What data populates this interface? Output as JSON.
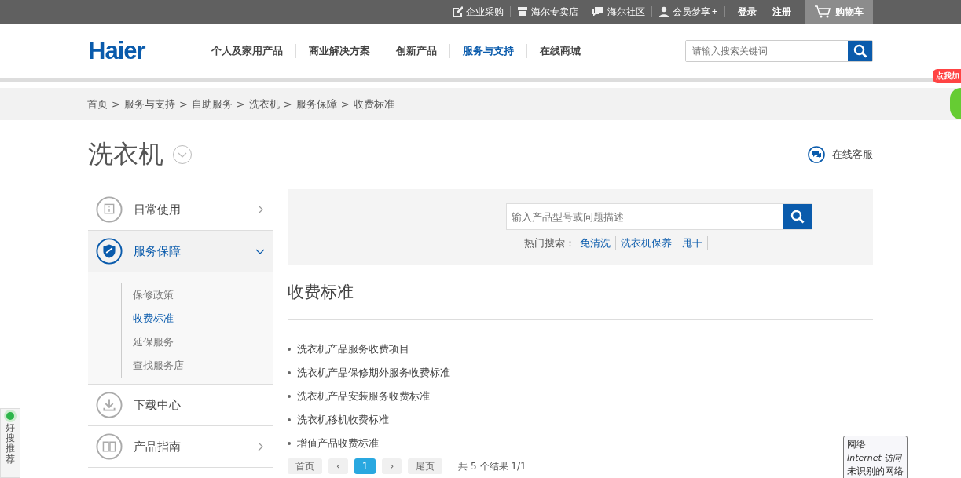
{
  "top_bar": {
    "links": [
      {
        "label": "企业采购"
      },
      {
        "label": "海尔专卖店"
      },
      {
        "label": "海尔社区"
      },
      {
        "label": "会员梦享",
        "sup": "+"
      }
    ],
    "login": "登录",
    "register": "注册",
    "cart": "购物车"
  },
  "header": {
    "logo": "Haier",
    "nav": [
      {
        "label": "个人及家用产品",
        "selected": false
      },
      {
        "label": "商业解决方案",
        "selected": false
      },
      {
        "label": "创新产品",
        "selected": false
      },
      {
        "label": "服务与支持",
        "selected": true
      },
      {
        "label": "在线商城",
        "selected": false
      }
    ],
    "search_placeholder": "请输入搜索关键词"
  },
  "breadcrumb": {
    "separator": ">",
    "items": [
      "首页",
      "服务与支持",
      "自助服务",
      "洗衣机",
      "服务保障",
      "收费标准"
    ]
  },
  "page_title": "洗衣机",
  "online_service": "在线客服",
  "sidebar": [
    {
      "label": "日常使用",
      "expanded": false,
      "chevron": true
    },
    {
      "label": "服务保障",
      "expanded": true,
      "chevron": true,
      "children": [
        {
          "label": "保修政策",
          "selected": false
        },
        {
          "label": "收费标准",
          "selected": true
        },
        {
          "label": "延保服务",
          "selected": false
        },
        {
          "label": "查找服务店",
          "selected": false
        }
      ]
    },
    {
      "label": "下载中心",
      "expanded": false,
      "chevron": false
    },
    {
      "label": "产品指南",
      "expanded": false,
      "chevron": true
    }
  ],
  "search_panel": {
    "placeholder": "输入产品型号或问题描述",
    "hot_label": "热门搜索：",
    "hot": [
      "免清洗",
      "洗衣机保养",
      "甩干"
    ]
  },
  "section_title": "收费标准",
  "items": [
    "洗衣机产品服务收费项目",
    "洗衣机产品保修期外服务收费标准",
    "洗衣机产品安装服务收费标准",
    "洗衣机移机收费标准",
    "增值产品收费标准"
  ],
  "pagination": {
    "first": "首页",
    "prev": "‹",
    "pages": [
      {
        "label": "1",
        "selected": true
      }
    ],
    "next": "›",
    "last": "尾页",
    "summary": "共 5 个结果 1/1"
  },
  "side_widget": {
    "label": "好搜推荐"
  },
  "promo_badge": "点我加",
  "tooltip": {
    "lines": [
      "网络",
      "Internet 访问",
      "未识别的网络"
    ]
  }
}
